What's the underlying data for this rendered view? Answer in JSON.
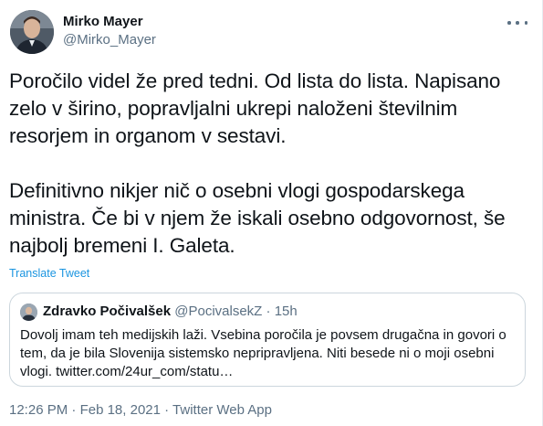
{
  "author": {
    "display_name": "Mirko Mayer",
    "handle": "@Mirko_Mayer"
  },
  "tweet": {
    "text": "Poročilo videl že pred tedni. Od lista do lista. Napisano zelo v širino, popravljalni ukrepi naloženi številnim resorjem in organom v sestavi.\n\nDefinitivno nikjer nič o osebni vlogi gospodarskega ministra. Če bi v njem že iskali osebno odgovornost, še najbolj bremeni I. Galeta.",
    "translate_label": "Translate Tweet"
  },
  "quote": {
    "display_name": "Zdravko Počivalšek",
    "handle": "@PocivalsekZ",
    "separator": "·",
    "age": "15h",
    "text": "Dovolj imam teh medijskih laži. Vsebina poročila je povsem drugačna in govori o tem, da je bila Slovenija sistemsko nepripravljena. Niti besede ni o moji osebni vlogi. twitter.com/24ur_com/statu…"
  },
  "footer": {
    "time": "12:26 PM",
    "date": "Feb 18, 2021",
    "source": "Twitter Web App",
    "separator": "·"
  },
  "icons": {
    "more": "more-horizontal-icon"
  },
  "colors": {
    "link": "#1b95e0",
    "secondary_text": "#5b7083",
    "border": "#ccd6dd"
  }
}
